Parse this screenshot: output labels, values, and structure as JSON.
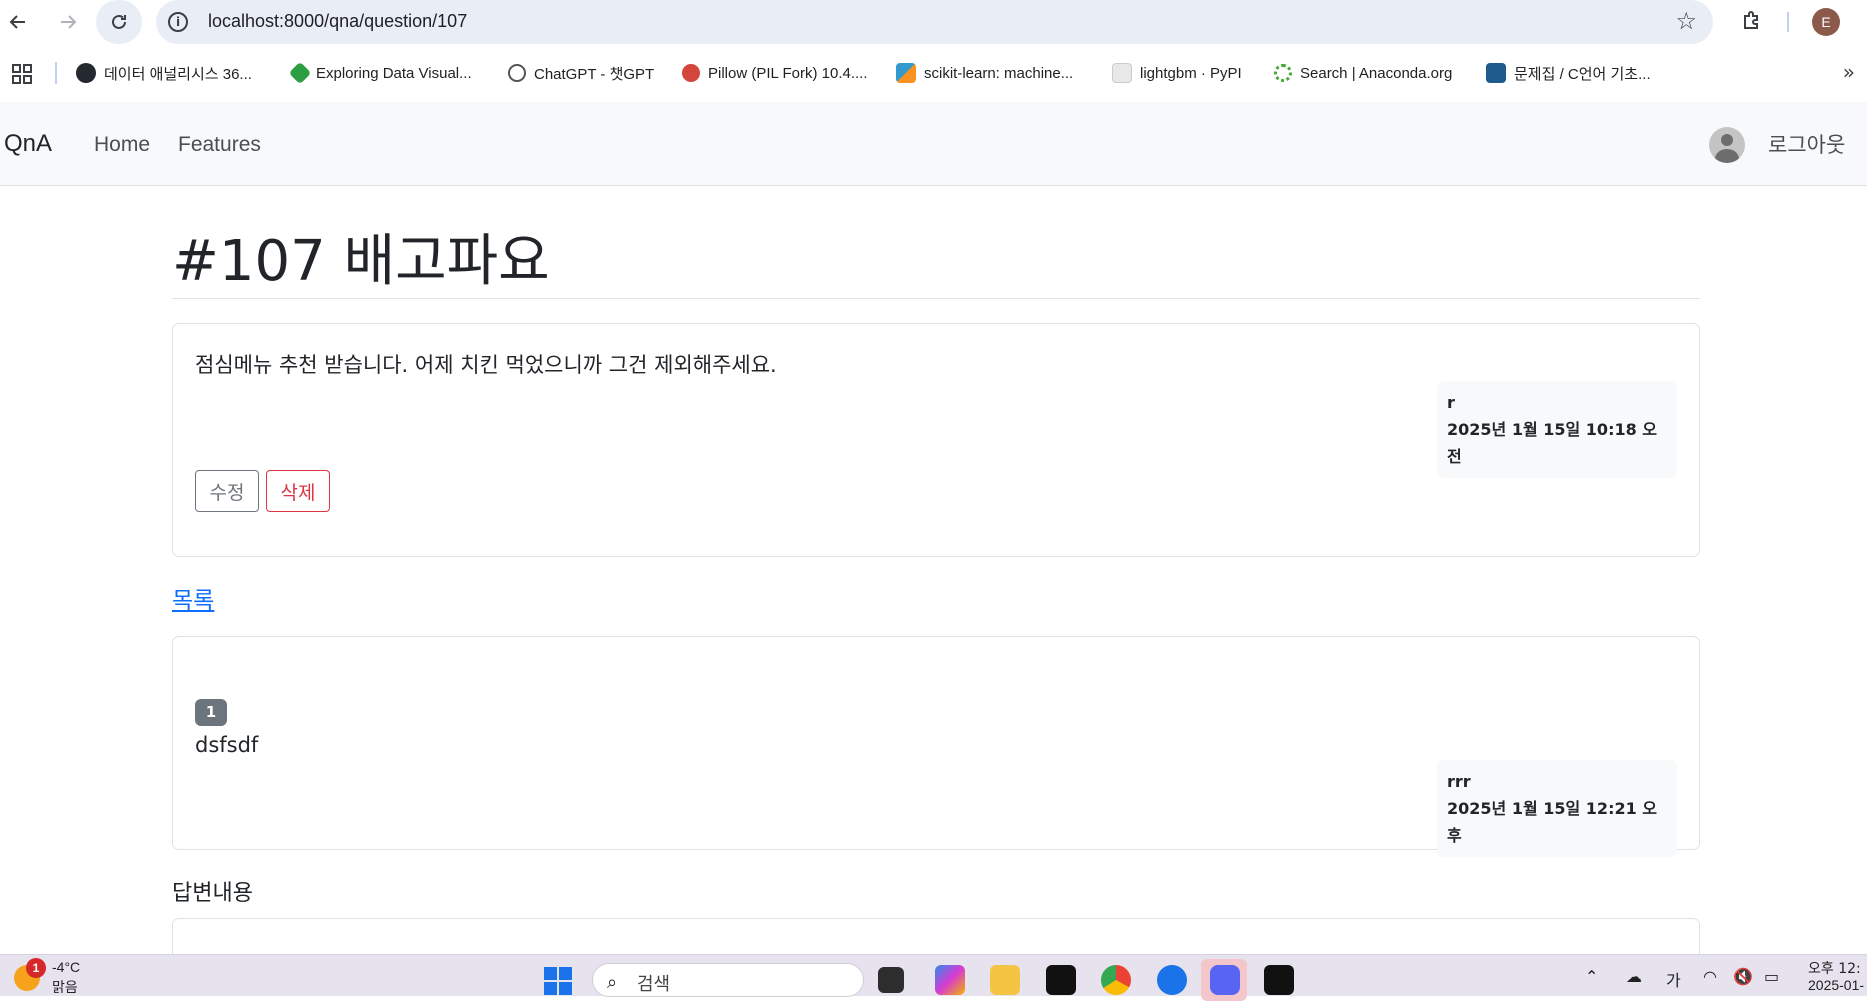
{
  "browser": {
    "url": "localhost:8000/qna/question/107",
    "profile_initial": "E",
    "bookmarks": [
      {
        "label": "데이터 애널리시스 36...",
        "icon": "github-icon",
        "color": "#24292f"
      },
      {
        "label": "Exploring Data Visual...",
        "icon": "exploring-icon",
        "color": "#2e9e44"
      },
      {
        "label": "ChatGPT - 챗GPT",
        "icon": "chatgpt-icon",
        "color": "#555555"
      },
      {
        "label": "Pillow (PIL Fork) 10.4....",
        "icon": "pillow-icon",
        "color": "#d2463c"
      },
      {
        "label": "scikit-learn: machine...",
        "icon": "sklearn-icon",
        "color": "#f7931e"
      },
      {
        "label": "lightgbm · PyPI",
        "icon": "pypi-icon",
        "color": "#e8e8e8"
      },
      {
        "label": "Search | Anaconda.org",
        "icon": "anaconda-icon",
        "color": "#44a833"
      },
      {
        "label": "문제집 / C언어 기초...",
        "icon": "codeup-icon",
        "color": "#1e5a8c"
      }
    ]
  },
  "navbar": {
    "brand": "QnA",
    "links": [
      "Home",
      "Features"
    ],
    "logout": "로그아웃"
  },
  "question": {
    "title": "#107 배고파요",
    "content": "점심메뉴 추천 받습니다. 어제 치킨 먹었으니까 그건 제외해주세요.",
    "author": "r",
    "date": "2025년 1월 15일 10:18 오전",
    "edit_label": "수정",
    "delete_label": "삭제"
  },
  "list_link": "목록",
  "answers": [
    {
      "badge": "1",
      "content": "dsfsdf",
      "author": "rrr",
      "date": "2025년 1월 15일 12:21 오후"
    }
  ],
  "answer_section": {
    "heading": "답변내용"
  },
  "taskbar": {
    "weather_badge": "1",
    "weather_temp": "-4°C",
    "weather_desc": "맑음",
    "search_label": "검색",
    "ime": "가",
    "clock_time": "오후 12:",
    "clock_date": "2025-01-"
  }
}
